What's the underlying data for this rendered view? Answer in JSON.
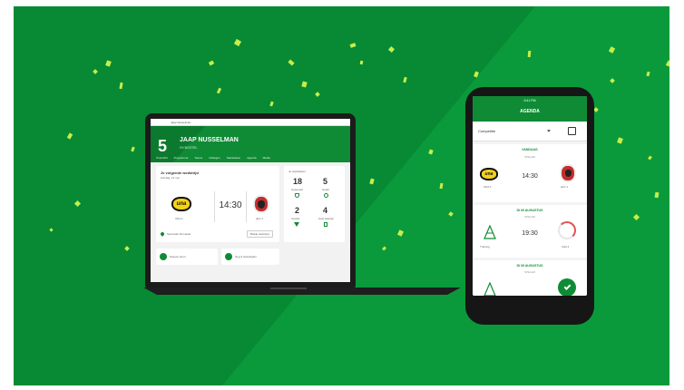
{
  "colors": {
    "bg_green": "#0a9a3b",
    "dark_green": "#078a33",
    "brand_green": "#0f8b35",
    "confetti": "#c6ee4a"
  },
  "laptop": {
    "nav": [
      "Jaap Nusselman"
    ],
    "hero": {
      "number": "5",
      "name": "JAAP NUSSELMAN",
      "sub": "VV BOXTEL"
    },
    "tabs": [
      "Overzicht",
      "Programma",
      "Teams",
      "Uitslagen",
      "Statistieken",
      "Agenda",
      "Media"
    ],
    "next_match": {
      "title": "Je volgende wedstrijd",
      "date": "Zondag, 13 mei",
      "time": "14:30",
      "home": "UNA 1",
      "away": "aFC 1",
      "home_logo": "una",
      "venue": "Sportpark De Heide",
      "more": "Bekijk wedstrijd"
    },
    "stats": {
      "title": "Je statistieken",
      "items": [
        {
          "value": "18",
          "label": "Gespeeld"
        },
        {
          "value": "5",
          "label": "Goals"
        },
        {
          "value": "2",
          "label": "Assists"
        },
        {
          "value": "4",
          "label": "Gele kaarten"
        }
      ]
    },
    "bottom": [
      "Nieuwe foto's",
      "Nog 3 wedstrijden"
    ]
  },
  "phone": {
    "status_time": "9:41 PM",
    "title": "AGENDA",
    "filter": "Competitie",
    "sections": [
      {
        "day": "VANDAAG",
        "tag": "SPELER",
        "time": "14:30",
        "home": "UNA 1",
        "away": "aFC 1"
      },
      {
        "day": "DI 09 AUGUSTUS",
        "tag": "SPELER",
        "time": "19:30",
        "home": "Training",
        "away": "Veld 2"
      },
      {
        "day": "DI 09 AUGUSTUS",
        "tag": "SPELER"
      }
    ]
  }
}
